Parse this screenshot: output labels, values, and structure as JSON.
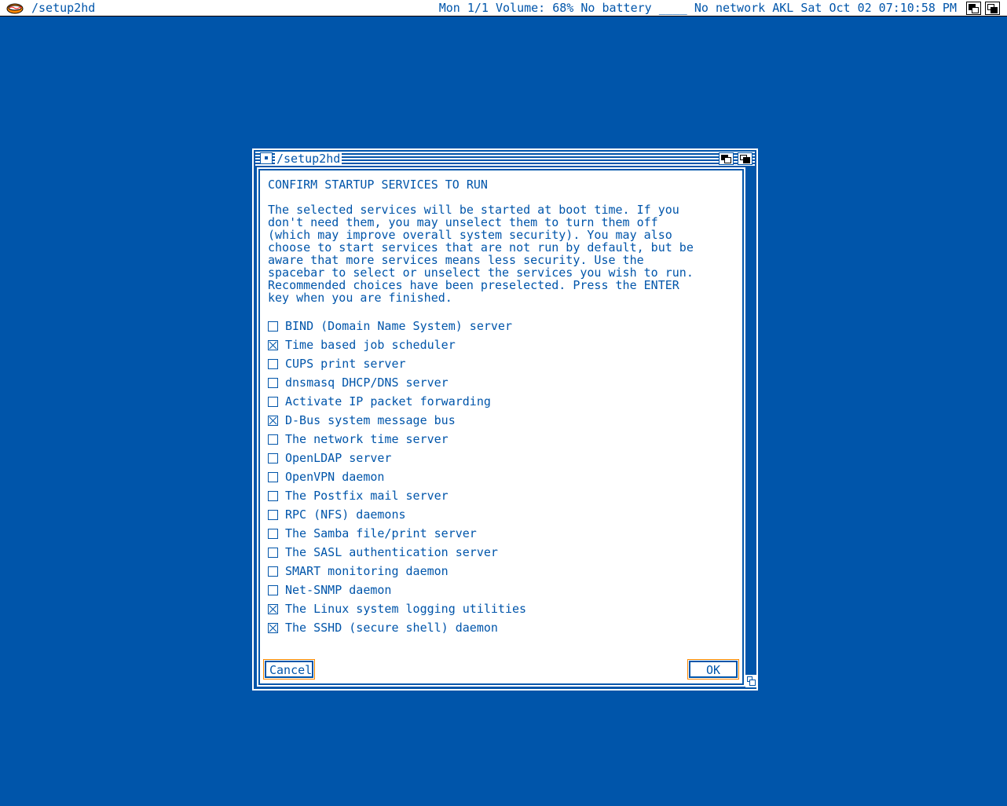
{
  "menubar": {
    "title": "/setup2hd",
    "status": "Mon 1/1 Volume: 68% No battery ____ No network AKL Sat Oct 02 07:10:58 PM"
  },
  "window": {
    "title": "/setup2hd",
    "heading": "CONFIRM STARTUP SERVICES TO RUN",
    "intro": "The selected services will be started at boot time. If you\ndon't need them, you may unselect them to turn them off\n(which may improve overall system security). You may also\nchoose to start services that are not run by default, but be\naware that more services means less security. Use the\nspacebar to select or unselect the services you wish to run.\nRecommended choices have been preselected. Press the ENTER\nkey when you are finished.",
    "services": [
      {
        "label": "BIND (Domain Name System) server",
        "checked": false
      },
      {
        "label": "Time based job scheduler",
        "checked": true
      },
      {
        "label": "CUPS print server",
        "checked": false
      },
      {
        "label": "dnsmasq DHCP/DNS server",
        "checked": false
      },
      {
        "label": "Activate IP packet forwarding",
        "checked": false
      },
      {
        "label": "D-Bus system message bus",
        "checked": true
      },
      {
        "label": "The network time server",
        "checked": false
      },
      {
        "label": "OpenLDAP server",
        "checked": false
      },
      {
        "label": "OpenVPN daemon",
        "checked": false
      },
      {
        "label": "The Postfix mail server",
        "checked": false
      },
      {
        "label": "RPC (NFS) daemons",
        "checked": false
      },
      {
        "label": "The Samba file/print server",
        "checked": false
      },
      {
        "label": "The SASL authentication server",
        "checked": false
      },
      {
        "label": "SMART monitoring daemon",
        "checked": false
      },
      {
        "label": "Net-SNMP daemon",
        "checked": false
      },
      {
        "label": "The Linux system logging utilities",
        "checked": true
      },
      {
        "label": "The SSHD (secure shell) daemon",
        "checked": true
      }
    ],
    "cancel_label": "Cancel",
    "ok_label": "OK"
  },
  "colors": {
    "background": "#0055aa",
    "panel": "#ffffff",
    "focus_border": "#ff8800"
  }
}
